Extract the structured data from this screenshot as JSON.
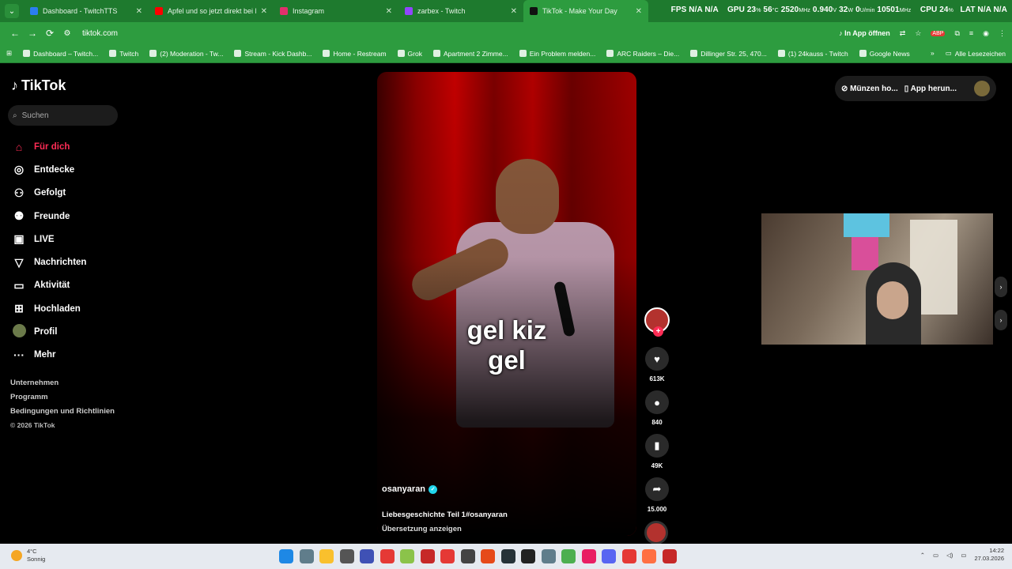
{
  "browser": {
    "tabs": [
      {
        "title": "Dashboard - TwitchTTS",
        "color": "#2b7ef1",
        "active": false
      },
      {
        "title": "Apfel und so jetzt direkt bei Du",
        "color": "#ff0000",
        "active": false
      },
      {
        "title": "Instagram",
        "color": "#e1306c",
        "active": false
      },
      {
        "title": "zarbex - Twitch",
        "color": "#9146ff",
        "active": false
      },
      {
        "title": "TikTok - Make Your Day",
        "color": "#111111",
        "active": true
      }
    ],
    "osd": {
      "fps_label": "FPS",
      "fps_value": "N/A",
      "fps_value2": "N/A",
      "gpu_label": "GPU",
      "gpu_load": "23",
      "gpu_temp": "56",
      "gpu_clock": "2520",
      "gpu_volt": "0.940",
      "gpu_power": "32",
      "gpu_fan": "0",
      "gpu_mem": "10501",
      "cpu_label": "CPU",
      "cpu_load": "24",
      "lat_label": "LAT",
      "lat_value": "N/A",
      "lat_value2": "N/A"
    },
    "url": "tiktok.com",
    "open_in_app": "In App öffnen",
    "bookmarks": [
      "Dashboard – Twitch...",
      "Twitch",
      "(2) Moderation - Tw...",
      "Stream - Kick Dashb...",
      "Home - Restream",
      "Grok",
      "Apartment 2 Zimme...",
      "Ein Problem melden...",
      "ARC Raiders – Die...",
      "Dillinger Str. 25, 470...",
      "(1) 24kauss - Twitch",
      "Google News"
    ],
    "bookmarks_more": "»",
    "all_bookmarks": "Alle Lesezeichen"
  },
  "tiktok": {
    "brand": "TikTok",
    "search_placeholder": "Suchen",
    "nav": [
      {
        "label": "Für dich",
        "icon": "home-icon",
        "glyph": "⌂",
        "active": true
      },
      {
        "label": "Entdecke",
        "icon": "compass-icon",
        "glyph": "◎",
        "active": false
      },
      {
        "label": "Gefolgt",
        "icon": "follow-icon",
        "glyph": "⚇",
        "active": false
      },
      {
        "label": "Freunde",
        "icon": "friends-icon",
        "glyph": "⚉",
        "active": false
      },
      {
        "label": "LIVE",
        "icon": "live-icon",
        "glyph": "▣",
        "active": false
      },
      {
        "label": "Nachrichten",
        "icon": "messages-icon",
        "glyph": "▽",
        "active": false
      },
      {
        "label": "Aktivität",
        "icon": "activity-icon",
        "glyph": "▭",
        "active": false
      },
      {
        "label": "Hochladen",
        "icon": "upload-icon",
        "glyph": "⊞",
        "active": false
      },
      {
        "label": "Profil",
        "icon": "profile-avatar",
        "glyph": "",
        "active": false
      },
      {
        "label": "Mehr",
        "icon": "more-icon",
        "glyph": "···",
        "active": false
      }
    ],
    "footer": [
      "Unternehmen",
      "Programm",
      "Bedingungen und Richtlinien"
    ],
    "copyright": "© 2026 TikTok",
    "topbar": {
      "coins": "Münzen ho...",
      "app": "App herun..."
    },
    "video": {
      "caption_line1": "gel kiz",
      "caption_line2": "gel",
      "author": "osanyaran",
      "description": "Liebesgeschichte Teil 1#osanyaran",
      "translate": "Übersetzung anzeigen",
      "progress": 0.98
    },
    "actions": {
      "likes": "613K",
      "comments": "840",
      "saves": "49K",
      "shares": "15.000"
    }
  },
  "taskbar": {
    "weather_temp": "4°C",
    "weather_text": "Sonnig",
    "weather_badge": "4",
    "time": "14:22",
    "date": "27.03.2026",
    "icons": [
      "#1e88e5",
      "#607d8b",
      "#f9c02d",
      "#555555",
      "#3f51b5",
      "#e53935",
      "#8bc34a",
      "#c62828",
      "#e53935",
      "#444444",
      "#e64a19",
      "#263238",
      "#222222",
      "#607d8b",
      "#4caf50",
      "#e91e63",
      "#5865f2",
      "#e53935",
      "#ff7043",
      "#c62828"
    ]
  }
}
